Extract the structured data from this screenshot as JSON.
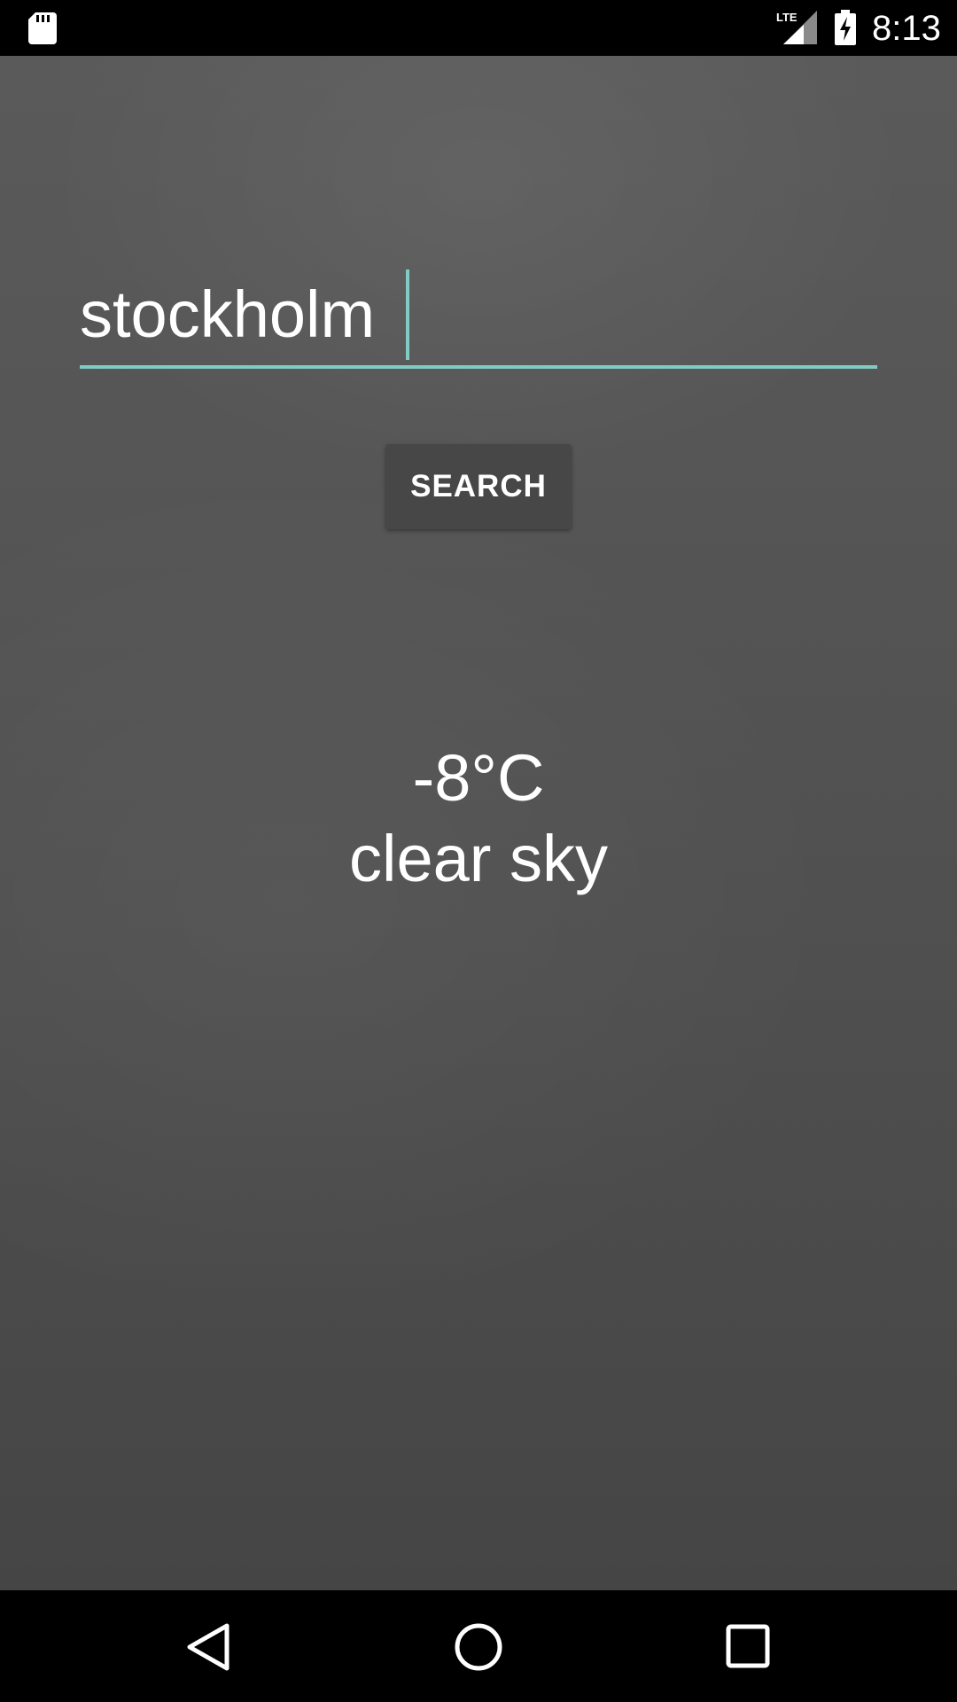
{
  "status_bar": {
    "left_icons": [
      "sd-card-icon"
    ],
    "network_label": "LTE",
    "right_icons": [
      "lte-signal-icon",
      "battery-charging-icon"
    ],
    "time": "8:13"
  },
  "search": {
    "input_value": "stockholm",
    "button_label": "SEARCH"
  },
  "weather": {
    "temperature": "-8°C",
    "condition": "clear sky"
  },
  "nav_bar": {
    "icons": [
      "back-icon",
      "home-icon",
      "recents-icon"
    ]
  },
  "colors": {
    "accent": "#80cbc4",
    "button_background": "#474747",
    "background": "#555555"
  }
}
